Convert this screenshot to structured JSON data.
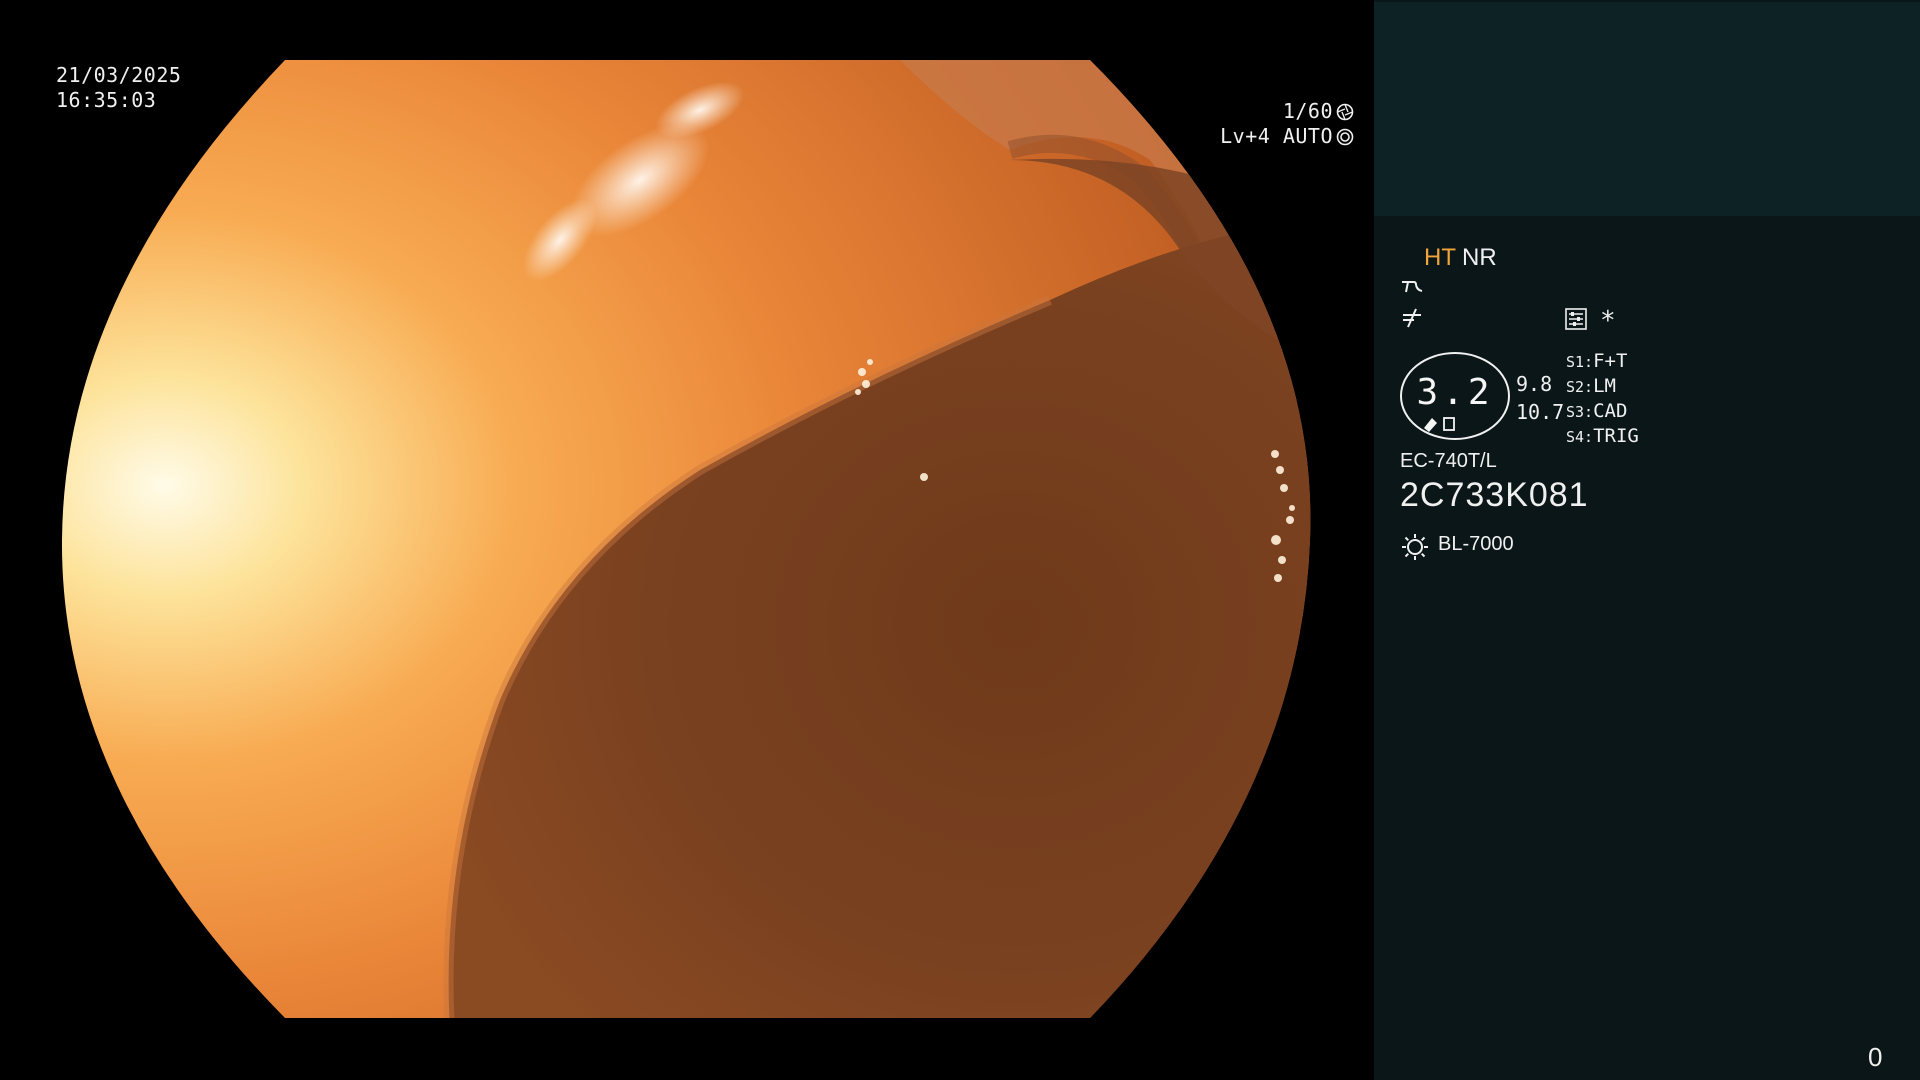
{
  "overlay": {
    "date": "21/03/2025",
    "time": "16:35:03",
    "shutter": "1/60",
    "level": "Lv+4 AUTO"
  },
  "panel": {
    "mode_ht": "HT",
    "mode_nr": "NR",
    "star": "*",
    "zoom": "3.2",
    "sub_value_1": "9.8",
    "sub_value_2": "10.7",
    "switches": [
      {
        "key": "S1:",
        "value": "F+T"
      },
      {
        "key": "S2:",
        "value": "LM"
      },
      {
        "key": "S3:",
        "value": "CAD"
      },
      {
        "key": "S4:",
        "value": "TRIG"
      }
    ],
    "scope_model": "EC-740T/L",
    "scope_serial": "2C733K081",
    "light_source": "BL-7000",
    "counter": "0"
  },
  "colors": {
    "ht_accent": "#f0a43c",
    "panel_bg": "#0a1617",
    "preview_bg": "#0d2224"
  },
  "icons": [
    "shutter-aperture-icon",
    "auto-iris-icon",
    "wave-icon",
    "not-equal-icon",
    "settings-list-icon",
    "zoom-indicator-icon",
    "light-source-icon"
  ]
}
